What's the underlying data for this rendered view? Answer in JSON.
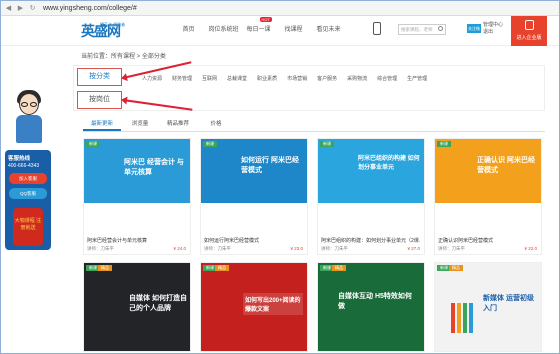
{
  "browser": {
    "url": "www.yingsheng.com/college/#"
  },
  "header": {
    "logo_text": "英盛网",
    "logo_tagline": "精英之 领路者",
    "menu": [
      "首页",
      "岗位系统班",
      "每日一课",
      "找课程",
      "看见未来"
    ],
    "hot_badge": "HOT",
    "search_placeholder": "搜索课程、老师",
    "weibo_label": "关注微博",
    "user_label": "管理中心",
    "user_sub": "退出",
    "enter_label": "进入企业版"
  },
  "breadcrumb": "当前位置：所有课程 > 全部分类",
  "filter": {
    "by_category": "按分类",
    "by_position": "按岗位",
    "categories": [
      "人力资源",
      "财务管理",
      "互联网",
      "总裁课堂",
      "职业素质",
      "市场营销",
      "客户服务",
      "采购物流",
      "综合管理",
      "生产管理"
    ]
  },
  "tabs": [
    "最新更新",
    "浏览量",
    "精品推荐",
    "价格"
  ],
  "courses": [
    {
      "tag": "新课",
      "title": "阿米巴经营会计与单元核算",
      "teacher": "讲师：刀朱平",
      "price": "¥ 24.0",
      "img_text": "阿米巴 经营会计 与单元核算",
      "bg": "#2a9bd6"
    },
    {
      "tag": "新课",
      "title": "如何运行阿米巴经营模式",
      "teacher": "讲师：刀朱平",
      "price": "¥ 23.0",
      "img_text": "如何运行 阿米巴经营模式",
      "bg": "#1d87c9"
    },
    {
      "tag": "新课",
      "title": "阿米巴组织的构建：如何划分事业单元（2课…",
      "teacher": "讲师：刀朱平",
      "price": "¥ 27.0",
      "img_text": "阿米巴组织的构建 如何划分事业单元",
      "bg": "#2aa5dd"
    },
    {
      "tag": "新课",
      "title": "正确认识阿米巴经营模式",
      "teacher": "讲师：刀朱平",
      "price": "¥ 22.0",
      "img_text": "正确认识 阿米巴经营模式",
      "bg": "#f3a11c"
    }
  ],
  "courses_row2": [
    {
      "tag": "新课",
      "tag2": "精品",
      "img_text": "自媒体 如何打造自己的个人品牌",
      "bg": "#222428"
    },
    {
      "tag": "新课",
      "tag2": "精品",
      "img_text": "如何写出200+阅读的爆款文案",
      "bg": "#c4201d"
    },
    {
      "tag": "新课",
      "tag2": "精品",
      "img_text": "自媒体互动 H5特效如何做",
      "bg": "#1a6b3a"
    },
    {
      "tag": "新课",
      "tag2": "精品",
      "img_text": "新媒体 运营初级入门",
      "bg": "#f2f2f2"
    }
  ],
  "sidebar": {
    "hotline_title": "客服热线",
    "hotline_number": "400-666-4343",
    "btn_join": "加入客服",
    "btn_qq": "QQ客服",
    "pack_text": "大咖课程 注册就送"
  },
  "colors": {
    "brand_blue": "#1a78c2",
    "accent_red": "#e8412c",
    "highlight_box": "#d9534f"
  }
}
